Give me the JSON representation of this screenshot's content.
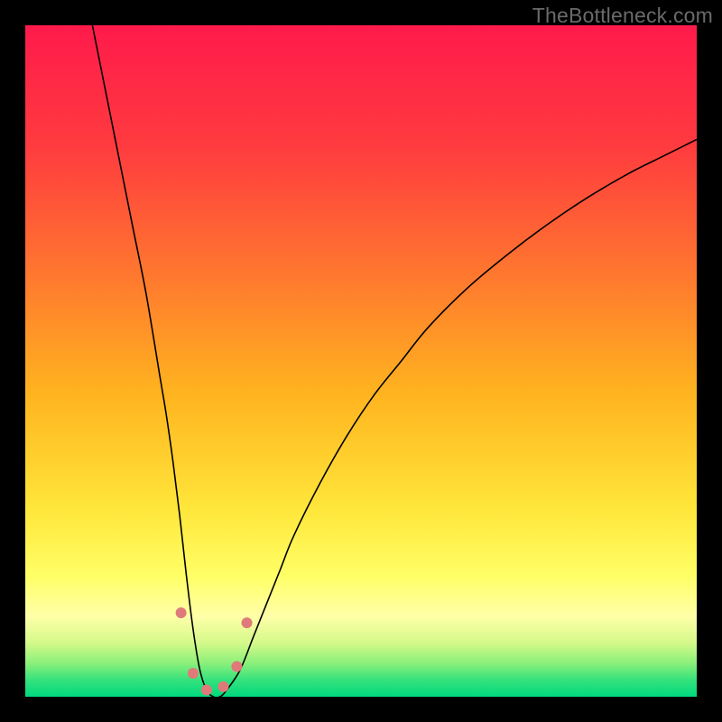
{
  "watermark": "TheBottleneck.com",
  "chart_data": {
    "type": "line",
    "title": "",
    "xlabel": "",
    "ylabel": "",
    "xlim": [
      0,
      100
    ],
    "ylim": [
      0,
      100
    ],
    "background_gradient": {
      "stops": [
        {
          "offset": 0.0,
          "color": "#ff1a4b"
        },
        {
          "offset": 0.18,
          "color": "#ff3b3f"
        },
        {
          "offset": 0.38,
          "color": "#ff7a2e"
        },
        {
          "offset": 0.55,
          "color": "#ffb41f"
        },
        {
          "offset": 0.72,
          "color": "#ffe63a"
        },
        {
          "offset": 0.82,
          "color": "#ffff66"
        },
        {
          "offset": 0.88,
          "color": "#ffffa8"
        },
        {
          "offset": 0.92,
          "color": "#d4f98a"
        },
        {
          "offset": 0.95,
          "color": "#8bf07a"
        },
        {
          "offset": 0.975,
          "color": "#35e27c"
        },
        {
          "offset": 1.0,
          "color": "#00d97e"
        }
      ]
    },
    "series": [
      {
        "name": "bottleneck-curve",
        "color": "#000000",
        "width": 1.6,
        "x": [
          10,
          12,
          14,
          16,
          18,
          20,
          21,
          22,
          23,
          24,
          25,
          26,
          27,
          28,
          29,
          30,
          32,
          34,
          36,
          38,
          40,
          44,
          48,
          52,
          56,
          60,
          66,
          72,
          78,
          84,
          90,
          95,
          100
        ],
        "values": [
          100,
          90,
          80,
          70,
          60,
          48,
          42,
          35,
          27,
          18,
          10,
          4,
          1,
          0,
          0,
          1,
          4,
          9,
          14,
          19,
          24,
          32,
          39,
          45,
          50,
          55,
          61,
          66,
          70.5,
          74.5,
          78,
          80.5,
          83
        ]
      }
    ],
    "markers": {
      "name": "highlight-points",
      "color": "#e07a7a",
      "radius": 6,
      "points": [
        {
          "x": 23.2,
          "y": 12.5
        },
        {
          "x": 25.0,
          "y": 3.5
        },
        {
          "x": 27.0,
          "y": 1.0
        },
        {
          "x": 29.5,
          "y": 1.5
        },
        {
          "x": 31.5,
          "y": 4.5
        },
        {
          "x": 33.0,
          "y": 11.0
        }
      ]
    }
  }
}
